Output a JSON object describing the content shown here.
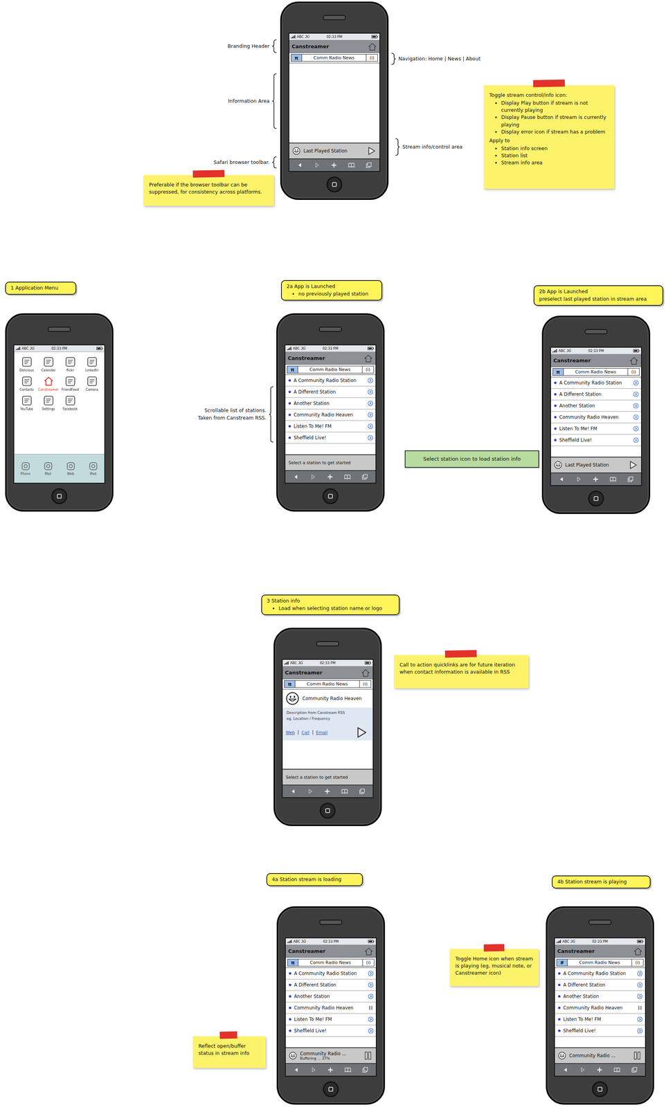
{
  "status_bar": {
    "carrier": "ABC",
    "network": "3G",
    "time": "02:33 PM"
  },
  "brand": "Canstreamer",
  "annotations": [
    {
      "lines": [
        "Branding Header"
      ]
    },
    {
      "lines": [
        "Information Area"
      ]
    },
    {
      "lines": [
        "Safari browser toolbar."
      ]
    },
    {
      "lines": [
        "Navigation: Home | News | About"
      ]
    },
    {
      "lines": [
        "Stream info/control area"
      ]
    },
    {
      "lines": [
        "Scrollable list of stations.",
        "Taken from Canstream RSS."
      ]
    }
  ],
  "notes": [
    {
      "kind": "sticky",
      "paragraphs": [
        {
          "text": "Preferable if the browser toolbar can be suppressed, for consistency across platforms.",
          "bullets": []
        }
      ]
    },
    {
      "kind": "sticky",
      "paragraphs": [
        {
          "text": "Toggle stream control/info icon:",
          "bullets": [
            "Display Play button if stream is not currently playing",
            "Display Pause button if stream is currently playing",
            "Display error icon if stream has a problem"
          ]
        },
        {
          "text": "Apply to",
          "bullets": [
            "Station info screen",
            "Station list",
            "Stream info area"
          ]
        }
      ]
    },
    {
      "kind": "action",
      "paragraphs": [
        {
          "text": "Select station icon to load station info",
          "bullets": []
        }
      ]
    },
    {
      "kind": "sticky",
      "paragraphs": [
        {
          "text": "Call to action quicklinks are for future iteration when contact information is available in RSS",
          "bullets": []
        }
      ]
    },
    {
      "kind": "sticky",
      "paragraphs": [
        {
          "text": "Toggle Home icon when stream is playing (eg, musical note, or Canstreamer icon)",
          "bullets": []
        }
      ]
    },
    {
      "kind": "sticky",
      "paragraphs": [
        {
          "text": "Reflect open/buffer status in stream info",
          "bullets": []
        }
      ]
    }
  ],
  "callouts": [
    {
      "title": "1 Application Menu",
      "bullets": [],
      "lines": []
    },
    {
      "title": "2a App is Launched",
      "bullets": [
        "no previously played station"
      ],
      "lines": []
    },
    {
      "title": "2b App is Launched",
      "bullets": [],
      "lines": [
        "preselect last played station in stream area"
      ]
    },
    {
      "title": "3 Station info",
      "bullets": [
        "Load when selecting station name or logo"
      ],
      "lines": []
    },
    {
      "title": "4a Station stream is loading",
      "bullets": [],
      "lines": []
    },
    {
      "title": "4b Station stream is playing",
      "bullets": [],
      "lines": []
    }
  ],
  "phones": [
    {
      "kind": "template",
      "nav": {
        "home": "π",
        "title": "Comm Radio News",
        "info": "(i)"
      },
      "stream": {
        "kind": "stream",
        "title": "Last Played Station",
        "state": "stopped"
      }
    },
    {
      "kind": "springboard",
      "apps": [
        {
          "label": "Delicious",
          "selected": false
        },
        {
          "label": "Calendar",
          "selected": false
        },
        {
          "label": "flickr",
          "selected": false
        },
        {
          "label": "LinkedIn",
          "selected": false
        },
        {
          "label": "Contacts",
          "selected": false
        },
        {
          "label": "Canstreamer",
          "selected": true
        },
        {
          "label": "FriendFeed",
          "selected": false
        },
        {
          "label": "Camera",
          "selected": false
        },
        {
          "label": "YouTube",
          "selected": false
        },
        {
          "label": "Settings",
          "selected": false
        },
        {
          "label": "Facebook",
          "selected": false
        }
      ],
      "dock": [
        {
          "label": "Phone"
        },
        {
          "label": "Mail"
        },
        {
          "label": "Web"
        },
        {
          "label": "iPod"
        }
      ]
    },
    {
      "kind": "list",
      "nav": {
        "home": "π",
        "title": "Comm Radio News",
        "info": "(i)"
      },
      "rows": [
        {
          "name": "A Community Radio Station",
          "playing": false
        },
        {
          "name": "A Different Station",
          "playing": false
        },
        {
          "name": "Another Station",
          "playing": false
        },
        {
          "name": "Community Radio Heaven",
          "playing": false
        },
        {
          "name": "Listen To Me! FM",
          "playing": false
        },
        {
          "name": "Sheffield Live!",
          "playing": false
        }
      ],
      "stream": {
        "kind": "prompt",
        "title": "Select a station to get started"
      }
    },
    {
      "kind": "list",
      "nav": {
        "home": "π",
        "title": "Comm Radio News",
        "info": "(i)"
      },
      "rows": [
        {
          "name": "A Community Radio Station",
          "playing": false
        },
        {
          "name": "A Different Station",
          "playing": false
        },
        {
          "name": "Another Station",
          "playing": false
        },
        {
          "name": "Community Radio Heaven",
          "playing": false
        },
        {
          "name": "Listen To Me! FM",
          "playing": false
        },
        {
          "name": "Sheffield Live!",
          "playing": false
        }
      ],
      "stream": {
        "kind": "stream",
        "title": "Last Played Station",
        "state": "stopped"
      }
    },
    {
      "kind": "info",
      "nav": {
        "home": "π",
        "title": "Comm Radio News",
        "info": "(i)"
      },
      "station": {
        "name": "Community Radio Heaven",
        "details": [
          "Description from Canstream RSS",
          "eg, Location / Frequency"
        ],
        "links": [
          "Web",
          "Call",
          "Email"
        ]
      },
      "stream": {
        "kind": "prompt",
        "title": "Select a station to get started"
      }
    },
    {
      "kind": "list",
      "nav": {
        "home": "π",
        "title": "Comm Radio News",
        "info": "(i)"
      },
      "rows": [
        {
          "name": "A Community Radio Station",
          "playing": false
        },
        {
          "name": "A Different Station",
          "playing": false
        },
        {
          "name": "Another Station",
          "playing": false
        },
        {
          "name": "Community Radio Heaven",
          "playing": true
        },
        {
          "name": "Listen To Me! FM",
          "playing": false
        },
        {
          "name": "Sheffield Live!",
          "playing": false
        }
      ],
      "stream": {
        "kind": "stream",
        "title": "Community Radio ...",
        "subtitle": "Buffering ... 37%",
        "state": "playing"
      }
    },
    {
      "kind": "list",
      "nav": {
        "home": "#",
        "title": "Comm Radio News",
        "info": "(i)"
      },
      "rows": [
        {
          "name": "A Community Radio Station",
          "playing": false
        },
        {
          "name": "A Different Station",
          "playing": false
        },
        {
          "name": "Another Station",
          "playing": false
        },
        {
          "name": "Community Radio Heaven",
          "playing": true
        },
        {
          "name": "Listen To Me! FM",
          "playing": false
        },
        {
          "name": "Sheffield Live!",
          "playing": false
        }
      ],
      "stream": {
        "kind": "stream",
        "title": "Community Radio ...",
        "state": "playing"
      }
    }
  ]
}
